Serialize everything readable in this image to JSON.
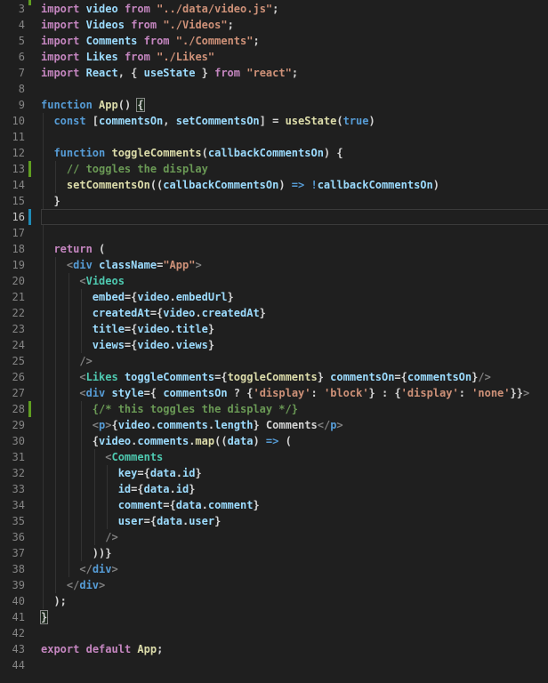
{
  "editor": {
    "kind": "code-editor-viewport",
    "language": "javascriptreact",
    "background": "#1f1f1f",
    "current_line": 16,
    "gutter": {
      "line_number_color": "#858585",
      "active_line_number_color": "#c6c6c6",
      "added_color": "#5f9e20",
      "modified_color": "#1f8ab5",
      "partial_top_indicator": "added"
    },
    "token_colors": {
      "k": "#C586C0",
      "b": "#569CD6",
      "v": "#9CDCFE",
      "f": "#DCDCAA",
      "s": "#CE9178",
      "c": "#6A9955",
      "t": "#4EC9B0",
      "g": "#808080",
      "p": "#D4D4D4",
      "x": "#D4D4D4"
    },
    "lines": [
      {
        "num": 3,
        "indent": 0,
        "guides": 0,
        "git": null,
        "tokens": [
          [
            "k",
            "import"
          ],
          [
            "p",
            " "
          ],
          [
            "v",
            "video"
          ],
          [
            "p",
            " "
          ],
          [
            "k",
            "from"
          ],
          [
            "p",
            " "
          ],
          [
            "s",
            "\"../data/video.js\""
          ],
          [
            "p",
            ";"
          ]
        ]
      },
      {
        "num": 4,
        "indent": 0,
        "guides": 0,
        "git": null,
        "tokens": [
          [
            "k",
            "import"
          ],
          [
            "p",
            " "
          ],
          [
            "v",
            "Videos"
          ],
          [
            "p",
            " "
          ],
          [
            "k",
            "from"
          ],
          [
            "p",
            " "
          ],
          [
            "s",
            "\"./Videos\""
          ],
          [
            "p",
            ";"
          ]
        ]
      },
      {
        "num": 5,
        "indent": 0,
        "guides": 0,
        "git": null,
        "tokens": [
          [
            "k",
            "import"
          ],
          [
            "p",
            " "
          ],
          [
            "v",
            "Comments"
          ],
          [
            "p",
            " "
          ],
          [
            "k",
            "from"
          ],
          [
            "p",
            " "
          ],
          [
            "s",
            "\"./Comments\""
          ],
          [
            "p",
            ";"
          ]
        ]
      },
      {
        "num": 6,
        "indent": 0,
        "guides": 0,
        "git": null,
        "tokens": [
          [
            "k",
            "import"
          ],
          [
            "p",
            " "
          ],
          [
            "v",
            "Likes"
          ],
          [
            "p",
            " "
          ],
          [
            "k",
            "from"
          ],
          [
            "p",
            " "
          ],
          [
            "s",
            "\"./Likes\""
          ]
        ]
      },
      {
        "num": 7,
        "indent": 0,
        "guides": 0,
        "git": null,
        "tokens": [
          [
            "k",
            "import"
          ],
          [
            "p",
            " "
          ],
          [
            "v",
            "React"
          ],
          [
            "p",
            ", { "
          ],
          [
            "v",
            "useState"
          ],
          [
            "p",
            " } "
          ],
          [
            "k",
            "from"
          ],
          [
            "p",
            " "
          ],
          [
            "s",
            "\"react\""
          ],
          [
            "p",
            ";"
          ]
        ]
      },
      {
        "num": 8,
        "indent": 0,
        "guides": 0,
        "git": null,
        "tokens": []
      },
      {
        "num": 9,
        "indent": 0,
        "guides": 0,
        "git": null,
        "tokens": [
          [
            "b",
            "function"
          ],
          [
            "p",
            " "
          ],
          [
            "f",
            "App"
          ],
          [
            "p",
            "() "
          ],
          [
            "x",
            "{"
          ]
        ]
      },
      {
        "num": 10,
        "indent": 2,
        "guides": 1,
        "git": null,
        "tokens": [
          [
            "b",
            "const"
          ],
          [
            "p",
            " ["
          ],
          [
            "v",
            "commentsOn"
          ],
          [
            "p",
            ", "
          ],
          [
            "v",
            "setCommentsOn"
          ],
          [
            "p",
            "] = "
          ],
          [
            "f",
            "useState"
          ],
          [
            "p",
            "("
          ],
          [
            "b",
            "true"
          ],
          [
            "p",
            ")"
          ]
        ]
      },
      {
        "num": 11,
        "indent": 0,
        "guides": 1,
        "git": null,
        "tokens": []
      },
      {
        "num": 12,
        "indent": 2,
        "guides": 1,
        "git": null,
        "tokens": [
          [
            "b",
            "function"
          ],
          [
            "p",
            " "
          ],
          [
            "f",
            "toggleComments"
          ],
          [
            "p",
            "("
          ],
          [
            "v",
            "callbackCommentsOn"
          ],
          [
            "p",
            ") {"
          ]
        ]
      },
      {
        "num": 13,
        "indent": 4,
        "guides": 2,
        "git": "added",
        "tokens": [
          [
            "c",
            "// toggles the display"
          ]
        ]
      },
      {
        "num": 14,
        "indent": 4,
        "guides": 2,
        "git": null,
        "tokens": [
          [
            "f",
            "setCommentsOn"
          ],
          [
            "p",
            "(("
          ],
          [
            "v",
            "callbackCommentsOn"
          ],
          [
            "p",
            ") "
          ],
          [
            "b",
            "=>"
          ],
          [
            "p",
            " "
          ],
          [
            "b",
            "!"
          ],
          [
            "v",
            "callbackCommentsOn"
          ],
          [
            "p",
            ")"
          ]
        ]
      },
      {
        "num": 15,
        "indent": 2,
        "guides": 1,
        "git": null,
        "tokens": [
          [
            "p",
            "}"
          ]
        ]
      },
      {
        "num": 16,
        "indent": 0,
        "guides": 0,
        "git": "modified",
        "tokens": []
      },
      {
        "num": 17,
        "indent": 0,
        "guides": 1,
        "git": null,
        "tokens": []
      },
      {
        "num": 18,
        "indent": 2,
        "guides": 1,
        "git": null,
        "tokens": [
          [
            "k",
            "return"
          ],
          [
            "p",
            " ("
          ]
        ]
      },
      {
        "num": 19,
        "indent": 4,
        "guides": 2,
        "git": null,
        "tokens": [
          [
            "g",
            "<"
          ],
          [
            "b",
            "div"
          ],
          [
            "p",
            " "
          ],
          [
            "v",
            "className"
          ],
          [
            "p",
            "="
          ],
          [
            "s",
            "\"App\""
          ],
          [
            "g",
            ">"
          ]
        ]
      },
      {
        "num": 20,
        "indent": 6,
        "guides": 3,
        "git": null,
        "tokens": [
          [
            "g",
            "<"
          ],
          [
            "t",
            "Videos"
          ]
        ]
      },
      {
        "num": 21,
        "indent": 8,
        "guides": 4,
        "git": null,
        "tokens": [
          [
            "v",
            "embed"
          ],
          [
            "p",
            "={"
          ],
          [
            "v",
            "video"
          ],
          [
            "p",
            "."
          ],
          [
            "v",
            "embedUrl"
          ],
          [
            "p",
            "}"
          ]
        ]
      },
      {
        "num": 22,
        "indent": 8,
        "guides": 4,
        "git": null,
        "tokens": [
          [
            "v",
            "createdAt"
          ],
          [
            "p",
            "={"
          ],
          [
            "v",
            "video"
          ],
          [
            "p",
            "."
          ],
          [
            "v",
            "createdAt"
          ],
          [
            "p",
            "}"
          ]
        ]
      },
      {
        "num": 23,
        "indent": 8,
        "guides": 4,
        "git": null,
        "tokens": [
          [
            "v",
            "title"
          ],
          [
            "p",
            "={"
          ],
          [
            "v",
            "video"
          ],
          [
            "p",
            "."
          ],
          [
            "v",
            "title"
          ],
          [
            "p",
            "}"
          ]
        ]
      },
      {
        "num": 24,
        "indent": 8,
        "guides": 4,
        "git": null,
        "tokens": [
          [
            "v",
            "views"
          ],
          [
            "p",
            "={"
          ],
          [
            "v",
            "video"
          ],
          [
            "p",
            "."
          ],
          [
            "v",
            "views"
          ],
          [
            "p",
            "}"
          ]
        ]
      },
      {
        "num": 25,
        "indent": 6,
        "guides": 3,
        "git": null,
        "tokens": [
          [
            "g",
            "/>"
          ]
        ]
      },
      {
        "num": 26,
        "indent": 6,
        "guides": 3,
        "git": null,
        "tokens": [
          [
            "g",
            "<"
          ],
          [
            "t",
            "Likes"
          ],
          [
            "p",
            " "
          ],
          [
            "v",
            "toggleComments"
          ],
          [
            "p",
            "={"
          ],
          [
            "f",
            "toggleComments"
          ],
          [
            "p",
            "} "
          ],
          [
            "v",
            "commentsOn"
          ],
          [
            "p",
            "={"
          ],
          [
            "v",
            "commentsOn"
          ],
          [
            "p",
            "}"
          ],
          [
            "g",
            "/>"
          ]
        ]
      },
      {
        "num": 27,
        "indent": 6,
        "guides": 3,
        "git": null,
        "tokens": [
          [
            "g",
            "<"
          ],
          [
            "b",
            "div"
          ],
          [
            "p",
            " "
          ],
          [
            "v",
            "style"
          ],
          [
            "p",
            "={ "
          ],
          [
            "v",
            "commentsOn"
          ],
          [
            "p",
            " ? {"
          ],
          [
            "s",
            "'display'"
          ],
          [
            "p",
            ": "
          ],
          [
            "s",
            "'block'"
          ],
          [
            "p",
            "} : {"
          ],
          [
            "s",
            "'display'"
          ],
          [
            "p",
            ": "
          ],
          [
            "s",
            "'none'"
          ],
          [
            "p",
            "}}"
          ],
          [
            "g",
            ">"
          ]
        ]
      },
      {
        "num": 28,
        "indent": 8,
        "guides": 4,
        "git": "added",
        "tokens": [
          [
            "c",
            "{/* this toggles the display */}"
          ]
        ]
      },
      {
        "num": 29,
        "indent": 8,
        "guides": 4,
        "git": null,
        "tokens": [
          [
            "g",
            "<"
          ],
          [
            "b",
            "p"
          ],
          [
            "g",
            ">"
          ],
          [
            "p",
            "{"
          ],
          [
            "v",
            "video"
          ],
          [
            "p",
            "."
          ],
          [
            "v",
            "comments"
          ],
          [
            "p",
            "."
          ],
          [
            "v",
            "length"
          ],
          [
            "p",
            "} Comments"
          ],
          [
            "g",
            "</"
          ],
          [
            "b",
            "p"
          ],
          [
            "g",
            ">"
          ]
        ]
      },
      {
        "num": 30,
        "indent": 8,
        "guides": 4,
        "git": null,
        "tokens": [
          [
            "p",
            "{"
          ],
          [
            "v",
            "video"
          ],
          [
            "p",
            "."
          ],
          [
            "v",
            "comments"
          ],
          [
            "p",
            "."
          ],
          [
            "f",
            "map"
          ],
          [
            "p",
            "(("
          ],
          [
            "v",
            "data"
          ],
          [
            "p",
            ") "
          ],
          [
            "b",
            "=>"
          ],
          [
            "p",
            " ("
          ]
        ]
      },
      {
        "num": 31,
        "indent": 10,
        "guides": 5,
        "git": null,
        "tokens": [
          [
            "g",
            "<"
          ],
          [
            "t",
            "Comments"
          ]
        ]
      },
      {
        "num": 32,
        "indent": 12,
        "guides": 6,
        "git": null,
        "tokens": [
          [
            "v",
            "key"
          ],
          [
            "p",
            "={"
          ],
          [
            "v",
            "data"
          ],
          [
            "p",
            "."
          ],
          [
            "v",
            "id"
          ],
          [
            "p",
            "}"
          ]
        ]
      },
      {
        "num": 33,
        "indent": 12,
        "guides": 6,
        "git": null,
        "tokens": [
          [
            "v",
            "id"
          ],
          [
            "p",
            "={"
          ],
          [
            "v",
            "data"
          ],
          [
            "p",
            "."
          ],
          [
            "v",
            "id"
          ],
          [
            "p",
            "}"
          ]
        ]
      },
      {
        "num": 34,
        "indent": 12,
        "guides": 6,
        "git": null,
        "tokens": [
          [
            "v",
            "comment"
          ],
          [
            "p",
            "={"
          ],
          [
            "v",
            "data"
          ],
          [
            "p",
            "."
          ],
          [
            "v",
            "comment"
          ],
          [
            "p",
            "}"
          ]
        ]
      },
      {
        "num": 35,
        "indent": 12,
        "guides": 6,
        "git": null,
        "tokens": [
          [
            "v",
            "user"
          ],
          [
            "p",
            "={"
          ],
          [
            "v",
            "data"
          ],
          [
            "p",
            "."
          ],
          [
            "v",
            "user"
          ],
          [
            "p",
            "}"
          ]
        ]
      },
      {
        "num": 36,
        "indent": 10,
        "guides": 5,
        "git": null,
        "tokens": [
          [
            "g",
            "/>"
          ]
        ]
      },
      {
        "num": 37,
        "indent": 8,
        "guides": 4,
        "git": null,
        "tokens": [
          [
            "p",
            "))}"
          ]
        ]
      },
      {
        "num": 38,
        "indent": 6,
        "guides": 3,
        "git": null,
        "tokens": [
          [
            "g",
            "</"
          ],
          [
            "b",
            "div"
          ],
          [
            "g",
            ">"
          ]
        ]
      },
      {
        "num": 39,
        "indent": 4,
        "guides": 2,
        "git": null,
        "tokens": [
          [
            "g",
            "</"
          ],
          [
            "b",
            "div"
          ],
          [
            "g",
            ">"
          ]
        ]
      },
      {
        "num": 40,
        "indent": 2,
        "guides": 1,
        "git": null,
        "tokens": [
          [
            "p",
            ");"
          ]
        ]
      },
      {
        "num": 41,
        "indent": 0,
        "guides": 0,
        "git": null,
        "tokens": [
          [
            "x",
            "}"
          ]
        ]
      },
      {
        "num": 42,
        "indent": 0,
        "guides": 0,
        "git": null,
        "tokens": []
      },
      {
        "num": 43,
        "indent": 0,
        "guides": 0,
        "git": null,
        "tokens": [
          [
            "k",
            "export"
          ],
          [
            "p",
            " "
          ],
          [
            "k",
            "default"
          ],
          [
            "p",
            " "
          ],
          [
            "f",
            "App"
          ],
          [
            "p",
            ";"
          ]
        ]
      },
      {
        "num": 44,
        "indent": 0,
        "guides": 0,
        "git": null,
        "tokens": []
      }
    ]
  }
}
